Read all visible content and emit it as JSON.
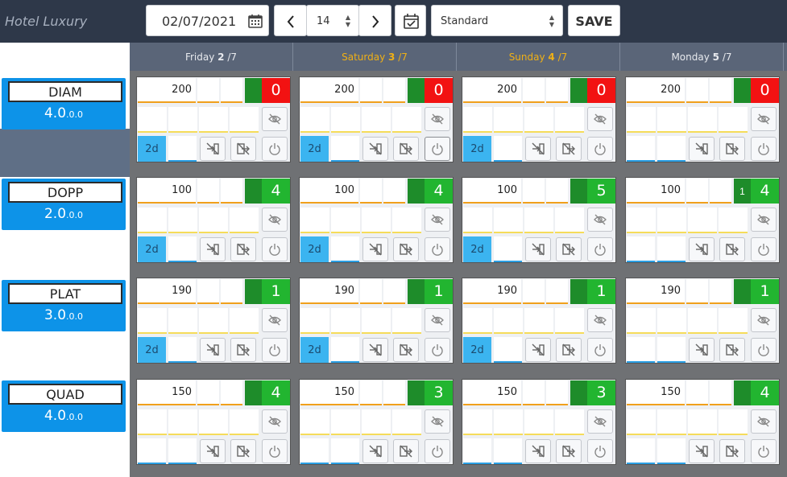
{
  "header": {
    "brand": "Hotel Luxury",
    "date": "02/07/2021",
    "days": "14",
    "rate_plan": "Standard",
    "save_label": "SAVE"
  },
  "day_headers": [
    {
      "label": "Friday",
      "num": "2",
      "month": "/7",
      "weekend": false
    },
    {
      "label": "Saturday",
      "num": "3",
      "month": "/7",
      "weekend": true
    },
    {
      "label": "Sunday",
      "num": "4",
      "month": "/7",
      "weekend": true
    },
    {
      "label": "Monday",
      "num": "5",
      "month": "/7",
      "weekend": false
    }
  ],
  "rooms": [
    {
      "code": "DIAM",
      "value_main": "4.0",
      "value_small": ".0.0",
      "cells": [
        {
          "price": "200",
          "avail": "0",
          "sub": "",
          "minstay": "2d",
          "status": "red"
        },
        {
          "price": "200",
          "avail": "0",
          "sub": "",
          "minstay": "2d",
          "status": "red"
        },
        {
          "price": "200",
          "avail": "0",
          "sub": "",
          "minstay": "2d",
          "status": "red"
        },
        {
          "price": "200",
          "avail": "0",
          "sub": "",
          "minstay": "",
          "status": "red"
        }
      ]
    },
    {
      "code": "DOPP",
      "value_main": "2.0",
      "value_small": ".0.0",
      "cells": [
        {
          "price": "100",
          "avail": "4",
          "sub": "",
          "minstay": "2d",
          "status": "grn"
        },
        {
          "price": "100",
          "avail": "4",
          "sub": "",
          "minstay": "2d",
          "status": "grn"
        },
        {
          "price": "100",
          "avail": "5",
          "sub": "",
          "minstay": "2d",
          "status": "grn"
        },
        {
          "price": "100",
          "avail": "4",
          "sub": "1",
          "minstay": "",
          "status": "grn"
        }
      ]
    },
    {
      "code": "PLAT",
      "value_main": "3.0",
      "value_small": ".0.0",
      "cells": [
        {
          "price": "190",
          "avail": "1",
          "sub": "",
          "minstay": "2d",
          "status": "grn"
        },
        {
          "price": "190",
          "avail": "1",
          "sub": "",
          "minstay": "2d",
          "status": "grn"
        },
        {
          "price": "190",
          "avail": "1",
          "sub": "",
          "minstay": "2d",
          "status": "grn"
        },
        {
          "price": "190",
          "avail": "1",
          "sub": "",
          "minstay": "",
          "status": "grn"
        }
      ]
    },
    {
      "code": "QUAD",
      "value_main": "4.0",
      "value_small": ".0.0",
      "cells": [
        {
          "price": "150",
          "avail": "4",
          "sub": "",
          "minstay": "",
          "status": "grn"
        },
        {
          "price": "150",
          "avail": "3",
          "sub": "",
          "minstay": "",
          "status": "grn"
        },
        {
          "price": "150",
          "avail": "3",
          "sub": "",
          "minstay": "",
          "status": "grn"
        },
        {
          "price": "150",
          "avail": "4",
          "sub": "",
          "minstay": "",
          "status": "grn"
        }
      ]
    }
  ],
  "icons": {
    "calendar": "calendar-icon",
    "prev": "chevron-left-icon",
    "next": "chevron-right-icon",
    "calcheck": "calendar-check-icon",
    "eye_off": "eye-off-icon",
    "no_arrival": "no-arrival-icon",
    "no_departure": "no-departure-icon",
    "power": "power-icon"
  },
  "colors": {
    "header_bg": "#2e3849",
    "room_blue": "#0d93e8",
    "avail_green": "#22b530",
    "avail_red": "#f21212",
    "weekend_text": "#f0b015",
    "minstay_blue": "#3bb4f0"
  }
}
